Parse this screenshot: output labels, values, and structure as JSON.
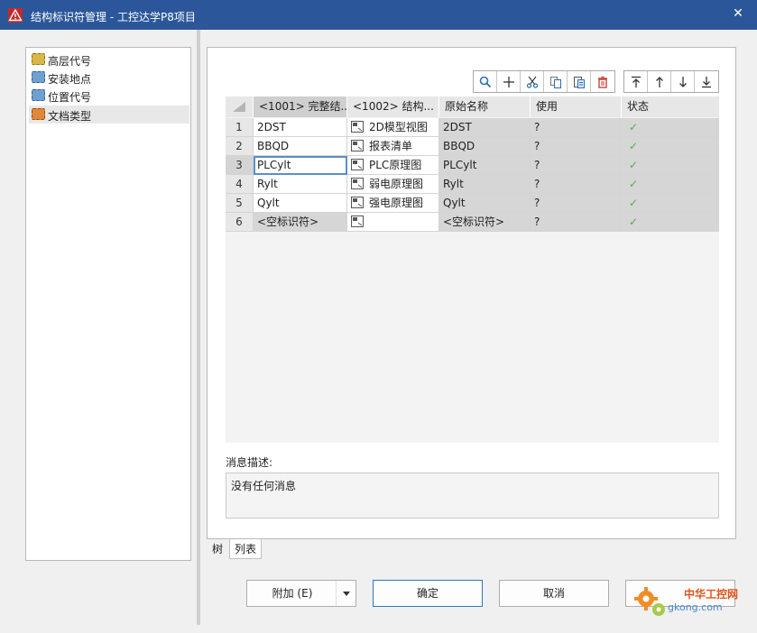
{
  "window": {
    "title": "结构标识符管理 - 工控达学P8项目",
    "close_label": "✕"
  },
  "tree": {
    "items": [
      {
        "label": "高层代号",
        "icon": "higher-level-icon",
        "color": "#d9b64a",
        "selected": false
      },
      {
        "label": "安装地点",
        "icon": "mounting-location-icon",
        "color": "#6fa0cf",
        "selected": false
      },
      {
        "label": "位置代号",
        "icon": "location-icon",
        "color": "#6fa0cf",
        "selected": false
      },
      {
        "label": "文档类型",
        "icon": "document-type-icon",
        "color": "#e0883a",
        "selected": true
      }
    ]
  },
  "toolbar": {
    "group1": [
      "search-icon",
      "add-icon",
      "cut-icon",
      "copy-icon",
      "paste-icon",
      "delete-icon"
    ],
    "group2": [
      "move-top-icon",
      "move-up-icon",
      "move-down-icon",
      "move-bottom-icon"
    ]
  },
  "grid": {
    "headers": [
      "",
      "<1001> 完整结...",
      "<1002> 结构...",
      "原始名称",
      "使用",
      "状态"
    ],
    "rows": [
      {
        "num": "1",
        "full": "2DST",
        "desc": "2D模型视图",
        "orig": "2DST",
        "use": "?",
        "status": "✓"
      },
      {
        "num": "2",
        "full": "BBQD",
        "desc": "报表清单",
        "orig": "BBQD",
        "use": "?",
        "status": "✓"
      },
      {
        "num": "3",
        "full": "PLCylt",
        "desc": "PLC原理图",
        "orig": "PLCylt",
        "use": "?",
        "status": "✓"
      },
      {
        "num": "4",
        "full": "Rylt",
        "desc": "弱电原理图",
        "orig": "Rylt",
        "use": "?",
        "status": "✓"
      },
      {
        "num": "5",
        "full": "Qylt",
        "desc": "强电原理图",
        "orig": "Qylt",
        "use": "?",
        "status": "✓"
      },
      {
        "num": "6",
        "full": "<空标识符>",
        "desc": "",
        "orig": "<空标识符>",
        "use": "?",
        "status": "✓"
      }
    ]
  },
  "message": {
    "label": "消息描述:",
    "text": "没有任何消息"
  },
  "tabs": [
    "树",
    "列表"
  ],
  "buttons": {
    "append": "附加 (E)",
    "ok": "确定",
    "cancel": "取消",
    "fourth": ""
  },
  "watermark": {
    "line1": "中华工控网",
    "line2": "gkong.com"
  },
  "colors": {
    "titlebar": "#2b579a",
    "status_check": "#4caf50",
    "focus_border": "#5b8fc9",
    "delete_icon": "#c0392b"
  }
}
